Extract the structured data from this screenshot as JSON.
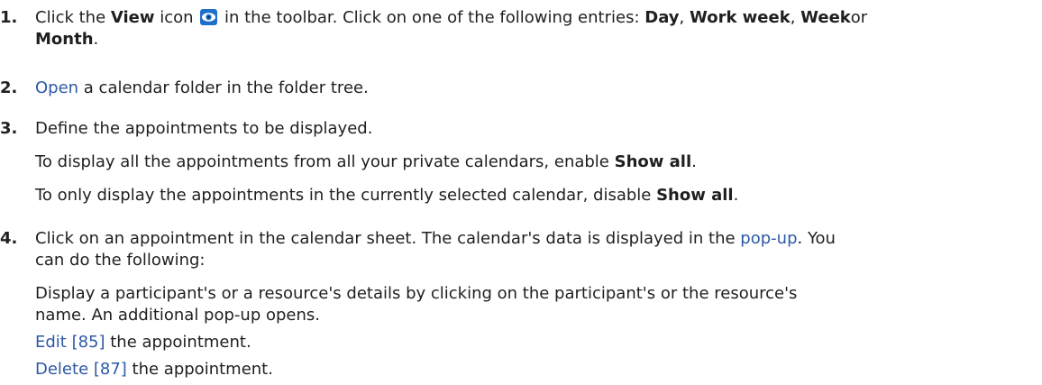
{
  "steps": [
    {
      "number": "1.",
      "p1": "Click the ",
      "view_label": "View",
      "p2": " icon ",
      "p3": " in the toolbar. Click on one of the following entries: ",
      "day": "Day",
      "sep1": ", ",
      "work_week": "Work week",
      "sep2": ", ",
      "week": "Week",
      "or": "or",
      "month": "Month",
      "end": "."
    },
    {
      "number": "2.",
      "link": "Open",
      "rest": " a calendar folder in the folder tree."
    },
    {
      "number": "3.",
      "text": "Define the appointments to be displayed.",
      "sub1_pre": "To display all the appointments from all your private calendars, enable ",
      "sub1_bold": "Show all",
      "sub1_end": ".",
      "sub2_pre": "To only display the appointments in the currently selected calendar, disable ",
      "sub2_bold": "Show all",
      "sub2_end": "."
    },
    {
      "number": "4.",
      "line1": "Click on an appointment in the calendar sheet. The calendar's data is displayed in the ",
      "popup_link": "pop-up",
      "line1_end": ". You",
      "line2": "can do the following:",
      "sub1_line1": "Display a participant's or a resource's details by clicking on the participant's or the resource's",
      "sub1_line2": "name. An additional pop-up opens.",
      "edit_link": "Edit [85]",
      "edit_rest": " the appointment.",
      "delete_link": "Delete [87]",
      "delete_rest": " the appointment."
    }
  ],
  "colors": {
    "link": "#2e59a6",
    "icon": "#1e6fc9"
  },
  "icons": {
    "view": "eye-icon"
  }
}
